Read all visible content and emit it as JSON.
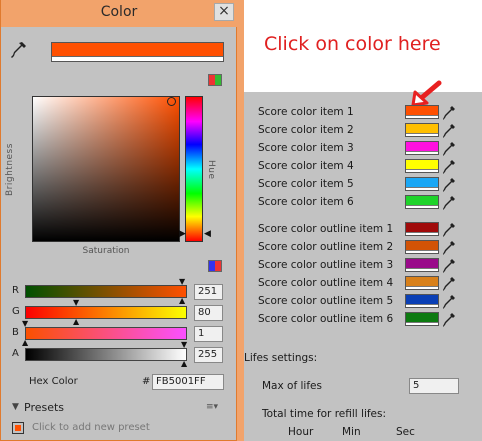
{
  "window": {
    "title": "Color",
    "close_glyph": "×"
  },
  "picker": {
    "current_color": "#ff5001",
    "labels": {
      "brightness": "Brightness",
      "hue": "Hue",
      "saturation": "Saturation"
    },
    "hue_color": "#ff5001",
    "channels": [
      {
        "label": "R",
        "value": "251"
      },
      {
        "label": "G",
        "value": "80"
      },
      {
        "label": "B",
        "value": "1"
      },
      {
        "label": "A",
        "value": "255"
      }
    ],
    "hex": {
      "label": "Hex Color",
      "hash": "#",
      "value": "FB5001FF"
    },
    "presets": {
      "label": "Presets",
      "add_text": "Click to add new preset"
    }
  },
  "banner": {
    "text": "Click on color here"
  },
  "inspector": {
    "score_colors": [
      {
        "label": "Score color item 1",
        "color": "#ff5001"
      },
      {
        "label": "Score color item 2",
        "color": "#ffbf00"
      },
      {
        "label": "Score color item 3",
        "color": "#ff10e0"
      },
      {
        "label": "Score color item 4",
        "color": "#ffff00"
      },
      {
        "label": "Score color item 5",
        "color": "#1aa7f5"
      },
      {
        "label": "Score color item 6",
        "color": "#1fd32a"
      }
    ],
    "outline_colors": [
      {
        "label": "Score color outline item 1",
        "color": "#a00a0a"
      },
      {
        "label": "Score color outline item 2",
        "color": "#d25306"
      },
      {
        "label": "Score color outline item 3",
        "color": "#9a0a8a"
      },
      {
        "label": "Score color outline item 4",
        "color": "#d8801a"
      },
      {
        "label": "Score color outline item 5",
        "color": "#0a3fb5"
      },
      {
        "label": "Score color outline item 6",
        "color": "#0c7a10"
      }
    ],
    "lifes_settings": "Lifes settings:",
    "max_lifes_label": "Max of lifes",
    "max_lifes_value": "5",
    "refill_label": "Total time for refill lifes:",
    "units": [
      "Hour",
      "Min",
      "Sec"
    ]
  }
}
